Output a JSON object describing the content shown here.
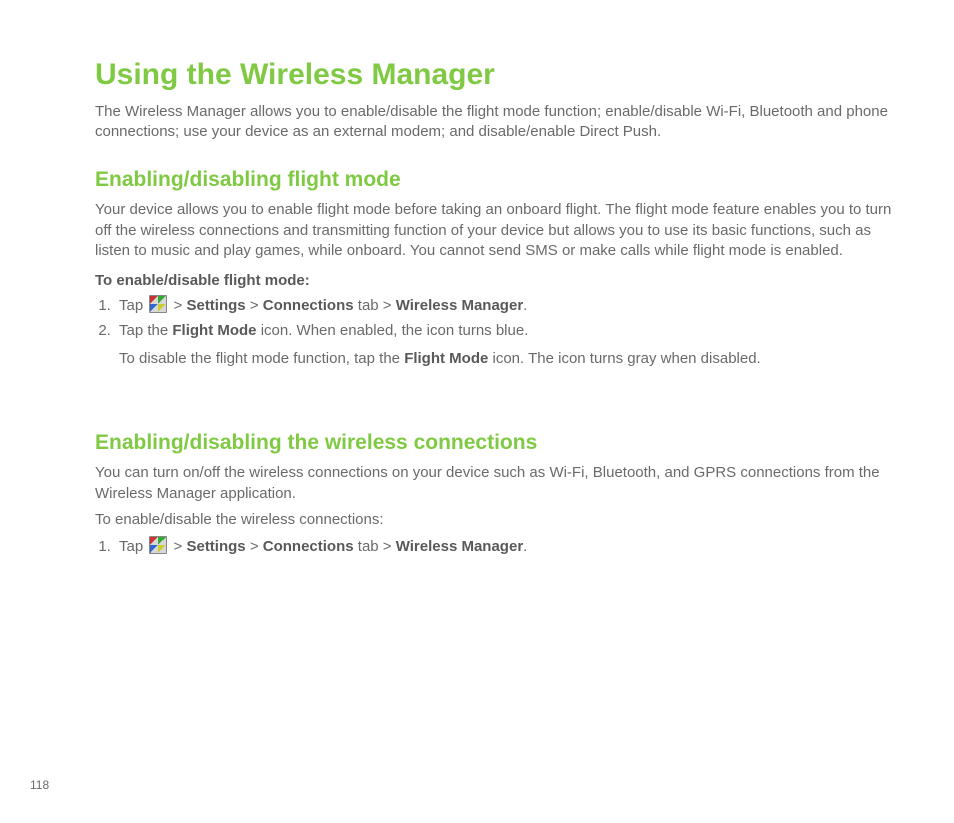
{
  "title": "Using the Wireless Manager",
  "intro": "The Wireless Manager allows you to enable/disable the flight mode function; enable/disable Wi-Fi, Bluetooth and phone connections; use your device as an external modem; and disable/enable Direct Push.",
  "section1": {
    "heading": "Enabling/disabling flight mode",
    "para": "Your device allows you to enable flight mode before taking an onboard flight. The flight mode feature enables you to turn off the wireless connections and transmitting function of your device but allows you to use its basic functions, such as listen to music and play games, while onboard. You cannot send SMS or make calls while flight mode is enabled.",
    "subhead": "To enable/disable flight mode:",
    "step1": {
      "prefix": "Tap ",
      "sep1": " > ",
      "settings": "Settings",
      "sep2": " > ",
      "connections": "Connections",
      "tab": " tab > ",
      "wireless_mgr": "Wireless Manager",
      "suffix": "."
    },
    "step2": {
      "prefix": "Tap the ",
      "flight_mode": "Flight Mode",
      "suffix": " icon. When enabled, the icon turns blue."
    },
    "step2_sub": {
      "prefix": "To disable the flight mode function, tap the ",
      "flight_mode": "Flight Mode",
      "suffix": " icon. The icon turns gray when disabled."
    }
  },
  "section2": {
    "heading": "Enabling/disabling the wireless connections",
    "para": "You can turn on/off the wireless connections on your device such as Wi-Fi, Bluetooth, and GPRS connections from the Wireless Manager application.",
    "subhead": "To enable/disable the wireless connections:",
    "step1": {
      "prefix": "Tap ",
      "sep1": " > ",
      "settings": "Settings",
      "sep2": " > ",
      "connections": "Connections",
      "tab": " tab > ",
      "wireless_mgr": "Wireless Manager",
      "suffix": "."
    }
  },
  "page_number": "118"
}
